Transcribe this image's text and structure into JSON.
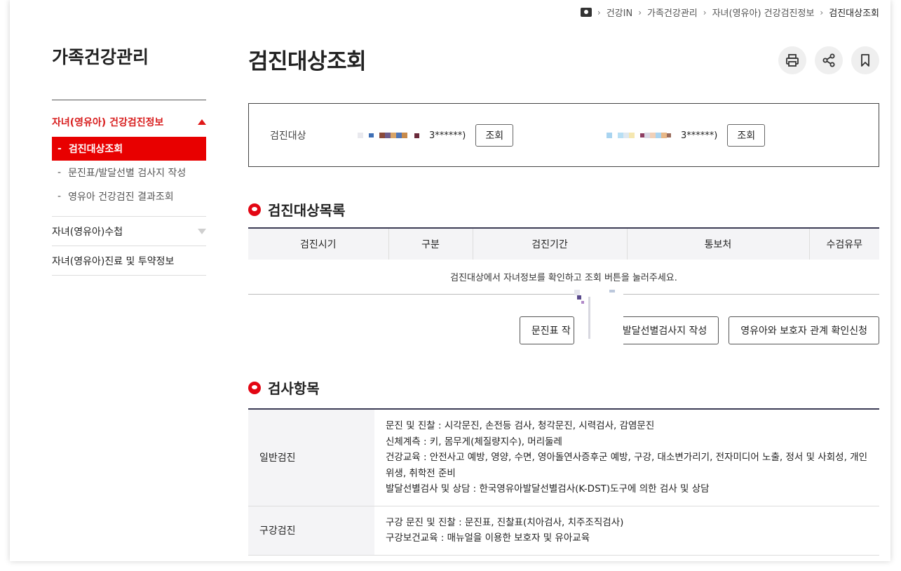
{
  "breadcrumb": [
    "건강IN",
    "가족건강관리",
    "자녀(영유아) 건강검진정보",
    "검진대상조회"
  ],
  "sidebar": {
    "title": "가족건강관리",
    "group1": {
      "label": "자녀(영유아) 건강검진정보",
      "items": [
        {
          "label": "검진대상조회",
          "active": true
        },
        {
          "label": "문진표/발달선별 검사지 작성"
        },
        {
          "label": "영유아 건강검진 결과조회"
        }
      ]
    },
    "others": [
      {
        "label": "자녀(영유아)수첩"
      },
      {
        "label": "자녀(영유아)진료 및 투약정보"
      }
    ]
  },
  "main": {
    "title": "검진대상조회",
    "tools": [
      "print-icon",
      "share-icon",
      "bookmark-icon"
    ],
    "search": {
      "label": "검진대상",
      "children": [
        {
          "masked_id": "3******)",
          "button": "조회"
        },
        {
          "masked_id": "3******)",
          "button": "조회"
        }
      ]
    },
    "list_section": {
      "title": "검진대상목록",
      "columns": [
        "검진시기",
        "구분",
        "검진기간",
        "통보처",
        "수검유무"
      ],
      "empty_message": "검진대상에서 자녀정보를 확인하고 조회 버튼을 눌러주세요."
    },
    "actions": [
      "문진표 작",
      "발달선별검사지 작성",
      "영유아와 보호자 관계 확인신청"
    ],
    "items_section": {
      "title": "검사항목",
      "rows": [
        {
          "label": "일반검진",
          "lines": [
            "문진 및 진찰 : 시각문진, 손전등 검사, 청각문진, 시력검사, 감염문진",
            "신체계측 : 키, 몸무게(체질량지수), 머리둘레",
            "건강교육 : 안전사고 예방, 영양, 수면, 영아돌연사증후군 예방, 구강, 대소변가리기, 전자미디어 노출, 정서 및 사회성, 개인위생, 취학전 준비",
            "발달선별검사 및 상담 : 한국영유아발달선별검사(K-DST)도구에 의한 검사 및 상담"
          ]
        },
        {
          "label": "구강검진",
          "lines": [
            "구강 문진 및 진찰 : 문진표, 진찰표(치아검사, 치주조직검사)",
            "구강보건교육 : 매뉴얼을 이용한 보호자 및 유아교육"
          ]
        }
      ]
    }
  },
  "colors": {
    "accent": "#e80000",
    "table_border": "#3c3c55"
  }
}
